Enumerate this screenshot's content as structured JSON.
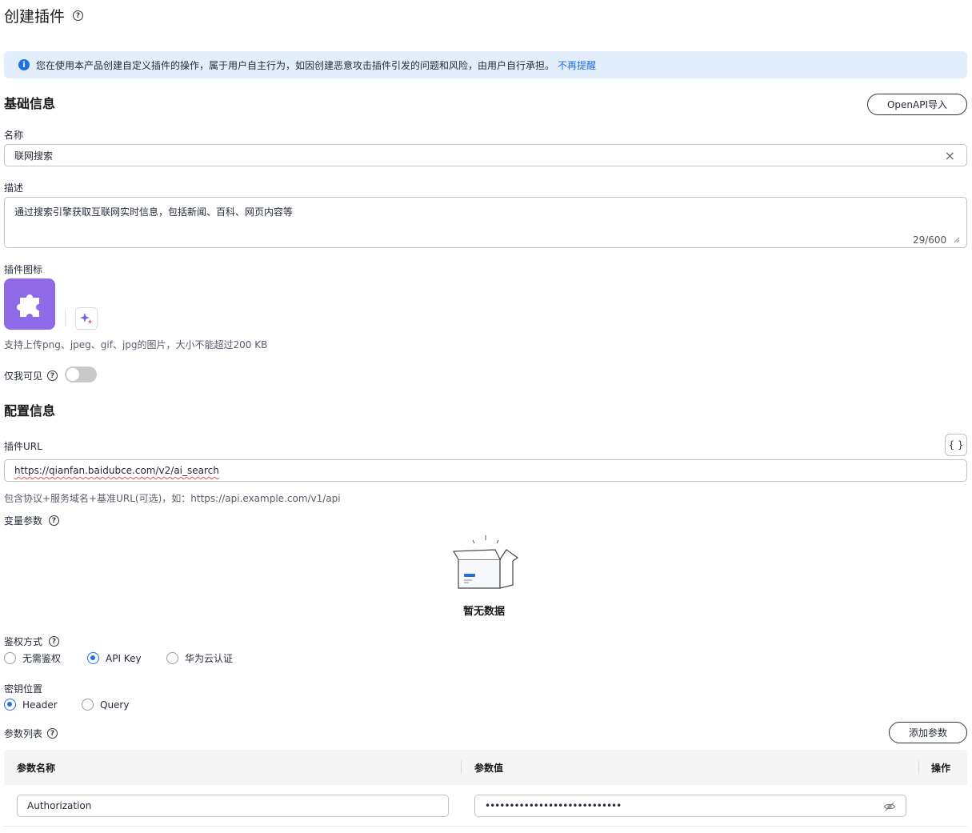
{
  "header": {
    "title": "创建插件",
    "help_icon": "?"
  },
  "notice": {
    "icon": "i",
    "text": "您在使用本产品创建自定义插件的操作，属于用户自主行为，如因创建恶意攻击插件引发的问题和风险，由用户自行承担。",
    "dismiss_link": "不再提醒"
  },
  "basic": {
    "section_title": "基础信息",
    "openapi_button": "OpenAPI导入",
    "name_label": "名称",
    "name_value": "联网搜索",
    "clear_icon": "×",
    "desc_label": "描述",
    "desc_value": "通过搜索引擎获取互联网实时信息，包括新闻、百科、网页内容等",
    "desc_counter": "29/600",
    "icon_label": "插件图标",
    "icon_hint": "支持上传png、jpeg、gif、jpg的图片，大小不能超过200 KB",
    "private_label": "仅我可见",
    "private_enabled": false
  },
  "config": {
    "section_title": "配置信息",
    "url_label": "插件URL",
    "code_button": "{ }",
    "url_value": "https://qianfan.baidubce.com/v2/ai_search",
    "url_hint": "包含协议+服务域名+基准URL(可选)，如：https://api.example.com/v1/api",
    "vars_label": "变量参数",
    "empty_text": "暂无数据",
    "auth_label": "鉴权方式",
    "auth_options": [
      "无需鉴权",
      "API Key",
      "华为云认证"
    ],
    "auth_selected": "API Key",
    "key_pos_label": "密钥位置",
    "key_pos_options": [
      "Header",
      "Query"
    ],
    "key_pos_selected": "Header",
    "params_label": "参数列表",
    "add_param_button": "添加参数",
    "table": {
      "headers": [
        "参数名称",
        "参数值",
        "操作"
      ],
      "rows": [
        {
          "name": "Authorization",
          "value": "••••••••••••••••••••••••••••"
        }
      ]
    }
  },
  "colors": {
    "primary": "#1f6fe5",
    "notice_bg": "#e3eefc",
    "plugin_icon_bg": "#8f6ae6"
  }
}
